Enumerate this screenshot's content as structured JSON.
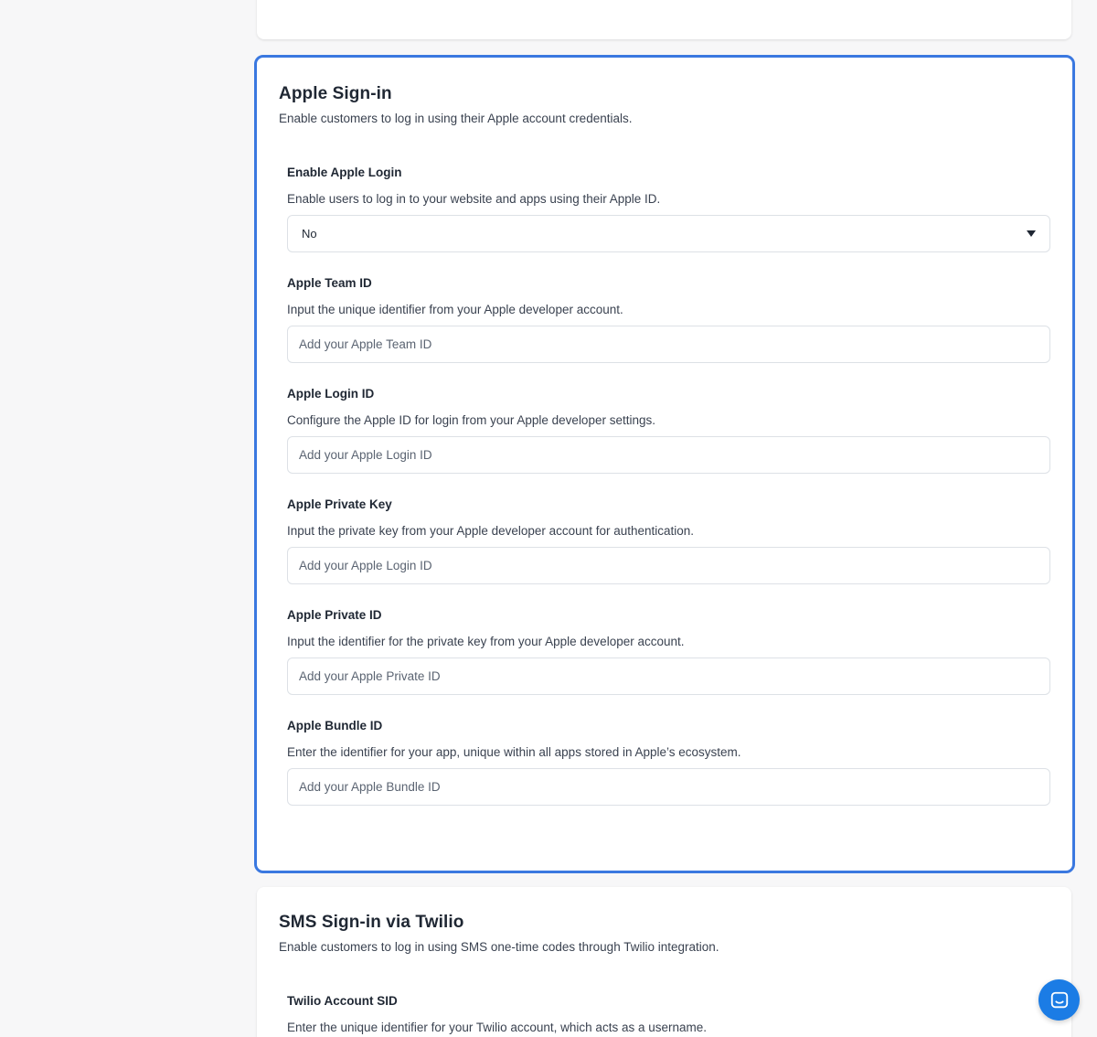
{
  "apple": {
    "title": "Apple Sign-in",
    "description": "Enable customers to log in using their Apple account credentials.",
    "enable_login": {
      "label": "Enable Apple Login",
      "help": "Enable users to log in to your website and apps using their Apple ID.",
      "value": "No"
    },
    "team_id": {
      "label": "Apple Team ID",
      "help": "Input the unique identifier from your Apple developer account.",
      "placeholder": "Add your Apple Team ID"
    },
    "login_id": {
      "label": "Apple Login ID",
      "help": "Configure the Apple ID for login from your Apple developer settings.",
      "placeholder": "Add your Apple Login ID"
    },
    "private_key": {
      "label": "Apple Private Key",
      "help": "Input the private key from your Apple developer account for authentication.",
      "placeholder": "Add your Apple Login ID"
    },
    "private_id": {
      "label": "Apple Private ID",
      "help": "Input the identifier for the private key from your Apple developer account.",
      "placeholder": "Add your Apple Private ID"
    },
    "bundle_id": {
      "label": "Apple Bundle ID",
      "help": "Enter the identifier for your app, unique within all apps stored in Apple’s ecosystem.",
      "placeholder": "Add your Apple Bundle ID"
    }
  },
  "sms": {
    "title": "SMS Sign-in via Twilio",
    "description": "Enable customers to log in using SMS one-time codes through Twilio integration.",
    "account_sid": {
      "label": "Twilio Account SID",
      "help": "Enter the unique identifier for your Twilio account, which acts as a username."
    }
  },
  "colors": {
    "accent": "#3a78e0",
    "chat_button": "#1b7ce5"
  },
  "icons": {
    "select_caret": "caret-down-icon",
    "chat": "chat-bubble-icon"
  }
}
